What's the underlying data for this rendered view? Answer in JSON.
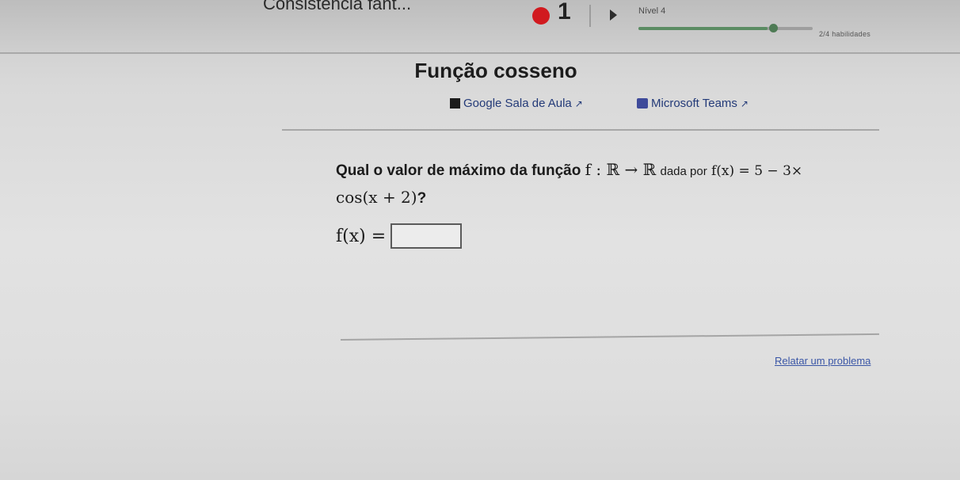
{
  "header": {
    "skill_name": "Consistência fant...",
    "streak_count": "1",
    "level_label": "Nível 4",
    "level_progress": 0.74,
    "skills_count": "2/4 habilidades"
  },
  "page": {
    "title": "Função cosseno",
    "share": {
      "google_label": "Google Sala de Aula",
      "teams_label": "Microsoft Teams"
    }
  },
  "question": {
    "prefix": "Qual o valor de máximo da função",
    "function_sig": "f : ℝ → ℝ",
    "middle": "dada por",
    "formula_part1": "f(x) = 5 − 3×",
    "formula_part2": "cos(x + 2)",
    "suffix": "?"
  },
  "answer": {
    "label": "f(x) =",
    "value": ""
  },
  "footer": {
    "report_label": "Relatar um problema"
  },
  "colors": {
    "streak": "#d11a1f",
    "link": "#233a78",
    "progress": "#5b8c63"
  }
}
